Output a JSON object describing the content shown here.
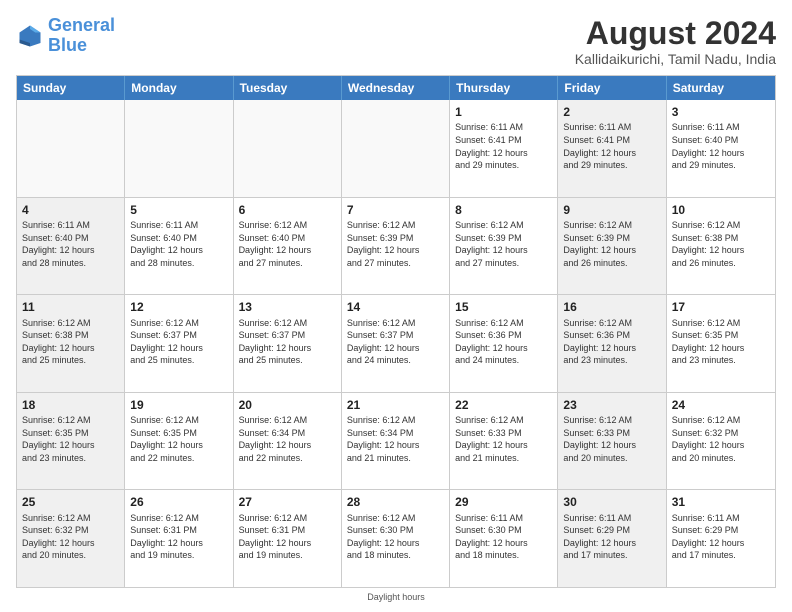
{
  "header": {
    "logo_line1": "General",
    "logo_line2": "Blue",
    "month_year": "August 2024",
    "location": "Kallidaikurichi, Tamil Nadu, India"
  },
  "day_headers": [
    "Sunday",
    "Monday",
    "Tuesday",
    "Wednesday",
    "Thursday",
    "Friday",
    "Saturday"
  ],
  "weeks": [
    [
      {
        "num": "",
        "info": "",
        "empty": true
      },
      {
        "num": "",
        "info": "",
        "empty": true
      },
      {
        "num": "",
        "info": "",
        "empty": true
      },
      {
        "num": "",
        "info": "",
        "empty": true
      },
      {
        "num": "1",
        "info": "Sunrise: 6:11 AM\nSunset: 6:41 PM\nDaylight: 12 hours\nand 29 minutes.",
        "empty": false
      },
      {
        "num": "2",
        "info": "Sunrise: 6:11 AM\nSunset: 6:41 PM\nDaylight: 12 hours\nand 29 minutes.",
        "empty": false
      },
      {
        "num": "3",
        "info": "Sunrise: 6:11 AM\nSunset: 6:40 PM\nDaylight: 12 hours\nand 29 minutes.",
        "empty": false
      }
    ],
    [
      {
        "num": "4",
        "info": "Sunrise: 6:11 AM\nSunset: 6:40 PM\nDaylight: 12 hours\nand 28 minutes.",
        "empty": false
      },
      {
        "num": "5",
        "info": "Sunrise: 6:11 AM\nSunset: 6:40 PM\nDaylight: 12 hours\nand 28 minutes.",
        "empty": false
      },
      {
        "num": "6",
        "info": "Sunrise: 6:12 AM\nSunset: 6:40 PM\nDaylight: 12 hours\nand 27 minutes.",
        "empty": false
      },
      {
        "num": "7",
        "info": "Sunrise: 6:12 AM\nSunset: 6:39 PM\nDaylight: 12 hours\nand 27 minutes.",
        "empty": false
      },
      {
        "num": "8",
        "info": "Sunrise: 6:12 AM\nSunset: 6:39 PM\nDaylight: 12 hours\nand 27 minutes.",
        "empty": false
      },
      {
        "num": "9",
        "info": "Sunrise: 6:12 AM\nSunset: 6:39 PM\nDaylight: 12 hours\nand 26 minutes.",
        "empty": false
      },
      {
        "num": "10",
        "info": "Sunrise: 6:12 AM\nSunset: 6:38 PM\nDaylight: 12 hours\nand 26 minutes.",
        "empty": false
      }
    ],
    [
      {
        "num": "11",
        "info": "Sunrise: 6:12 AM\nSunset: 6:38 PM\nDaylight: 12 hours\nand 25 minutes.",
        "empty": false
      },
      {
        "num": "12",
        "info": "Sunrise: 6:12 AM\nSunset: 6:37 PM\nDaylight: 12 hours\nand 25 minutes.",
        "empty": false
      },
      {
        "num": "13",
        "info": "Sunrise: 6:12 AM\nSunset: 6:37 PM\nDaylight: 12 hours\nand 25 minutes.",
        "empty": false
      },
      {
        "num": "14",
        "info": "Sunrise: 6:12 AM\nSunset: 6:37 PM\nDaylight: 12 hours\nand 24 minutes.",
        "empty": false
      },
      {
        "num": "15",
        "info": "Sunrise: 6:12 AM\nSunset: 6:36 PM\nDaylight: 12 hours\nand 24 minutes.",
        "empty": false
      },
      {
        "num": "16",
        "info": "Sunrise: 6:12 AM\nSunset: 6:36 PM\nDaylight: 12 hours\nand 23 minutes.",
        "empty": false
      },
      {
        "num": "17",
        "info": "Sunrise: 6:12 AM\nSunset: 6:35 PM\nDaylight: 12 hours\nand 23 minutes.",
        "empty": false
      }
    ],
    [
      {
        "num": "18",
        "info": "Sunrise: 6:12 AM\nSunset: 6:35 PM\nDaylight: 12 hours\nand 23 minutes.",
        "empty": false
      },
      {
        "num": "19",
        "info": "Sunrise: 6:12 AM\nSunset: 6:35 PM\nDaylight: 12 hours\nand 22 minutes.",
        "empty": false
      },
      {
        "num": "20",
        "info": "Sunrise: 6:12 AM\nSunset: 6:34 PM\nDaylight: 12 hours\nand 22 minutes.",
        "empty": false
      },
      {
        "num": "21",
        "info": "Sunrise: 6:12 AM\nSunset: 6:34 PM\nDaylight: 12 hours\nand 21 minutes.",
        "empty": false
      },
      {
        "num": "22",
        "info": "Sunrise: 6:12 AM\nSunset: 6:33 PM\nDaylight: 12 hours\nand 21 minutes.",
        "empty": false
      },
      {
        "num": "23",
        "info": "Sunrise: 6:12 AM\nSunset: 6:33 PM\nDaylight: 12 hours\nand 20 minutes.",
        "empty": false
      },
      {
        "num": "24",
        "info": "Sunrise: 6:12 AM\nSunset: 6:32 PM\nDaylight: 12 hours\nand 20 minutes.",
        "empty": false
      }
    ],
    [
      {
        "num": "25",
        "info": "Sunrise: 6:12 AM\nSunset: 6:32 PM\nDaylight: 12 hours\nand 20 minutes.",
        "empty": false
      },
      {
        "num": "26",
        "info": "Sunrise: 6:12 AM\nSunset: 6:31 PM\nDaylight: 12 hours\nand 19 minutes.",
        "empty": false
      },
      {
        "num": "27",
        "info": "Sunrise: 6:12 AM\nSunset: 6:31 PM\nDaylight: 12 hours\nand 19 minutes.",
        "empty": false
      },
      {
        "num": "28",
        "info": "Sunrise: 6:12 AM\nSunset: 6:30 PM\nDaylight: 12 hours\nand 18 minutes.",
        "empty": false
      },
      {
        "num": "29",
        "info": "Sunrise: 6:11 AM\nSunset: 6:30 PM\nDaylight: 12 hours\nand 18 minutes.",
        "empty": false
      },
      {
        "num": "30",
        "info": "Sunrise: 6:11 AM\nSunset: 6:29 PM\nDaylight: 12 hours\nand 17 minutes.",
        "empty": false
      },
      {
        "num": "31",
        "info": "Sunrise: 6:11 AM\nSunset: 6:29 PM\nDaylight: 12 hours\nand 17 minutes.",
        "empty": false
      }
    ]
  ],
  "footer": "Daylight hours"
}
